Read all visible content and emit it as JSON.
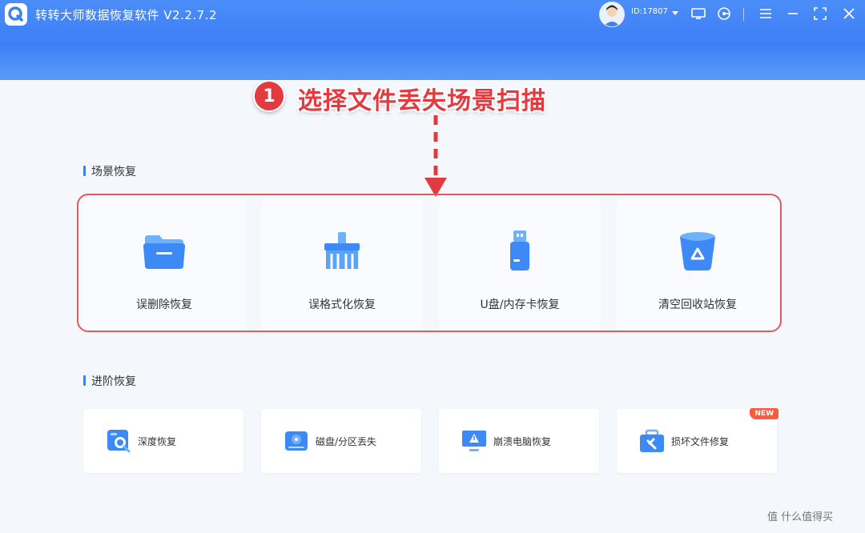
{
  "app": {
    "title": "转转大师数据恢复软件 V2.2.7.2",
    "user_id": "ID:17807",
    "accent": "#3d7ff6"
  },
  "header_icons": [
    "user-dropdown-chevron-icon",
    "screen-icon",
    "support-icon",
    "menu-icon",
    "minimize-icon",
    "maximize-icon",
    "close-icon"
  ],
  "annotation": {
    "step_number": "1",
    "text": "选择文件丢失场景扫描",
    "color": "#e23a3f"
  },
  "scene_section": {
    "title": "场景恢复",
    "cards": [
      {
        "label": "误删除恢复",
        "icon": "folder-icon"
      },
      {
        "label": "误格式化恢复",
        "icon": "broom-icon"
      },
      {
        "label": "U盘/内存卡恢复",
        "icon": "usb-drive-icon"
      },
      {
        "label": "清空回收站恢复",
        "icon": "recycle-bin-icon"
      }
    ]
  },
  "advanced_section": {
    "title": "进阶恢复",
    "cards": [
      {
        "label": "深度恢复",
        "icon": "deep-scan-icon"
      },
      {
        "label": "磁盘/分区丢失",
        "icon": "disk-icon"
      },
      {
        "label": "崩溃电脑恢复",
        "icon": "crashed-pc-icon"
      },
      {
        "label": "损坏文件修复",
        "icon": "repair-toolbox-icon",
        "badge": "NEW"
      }
    ]
  },
  "watermark": "值 什么值得买"
}
